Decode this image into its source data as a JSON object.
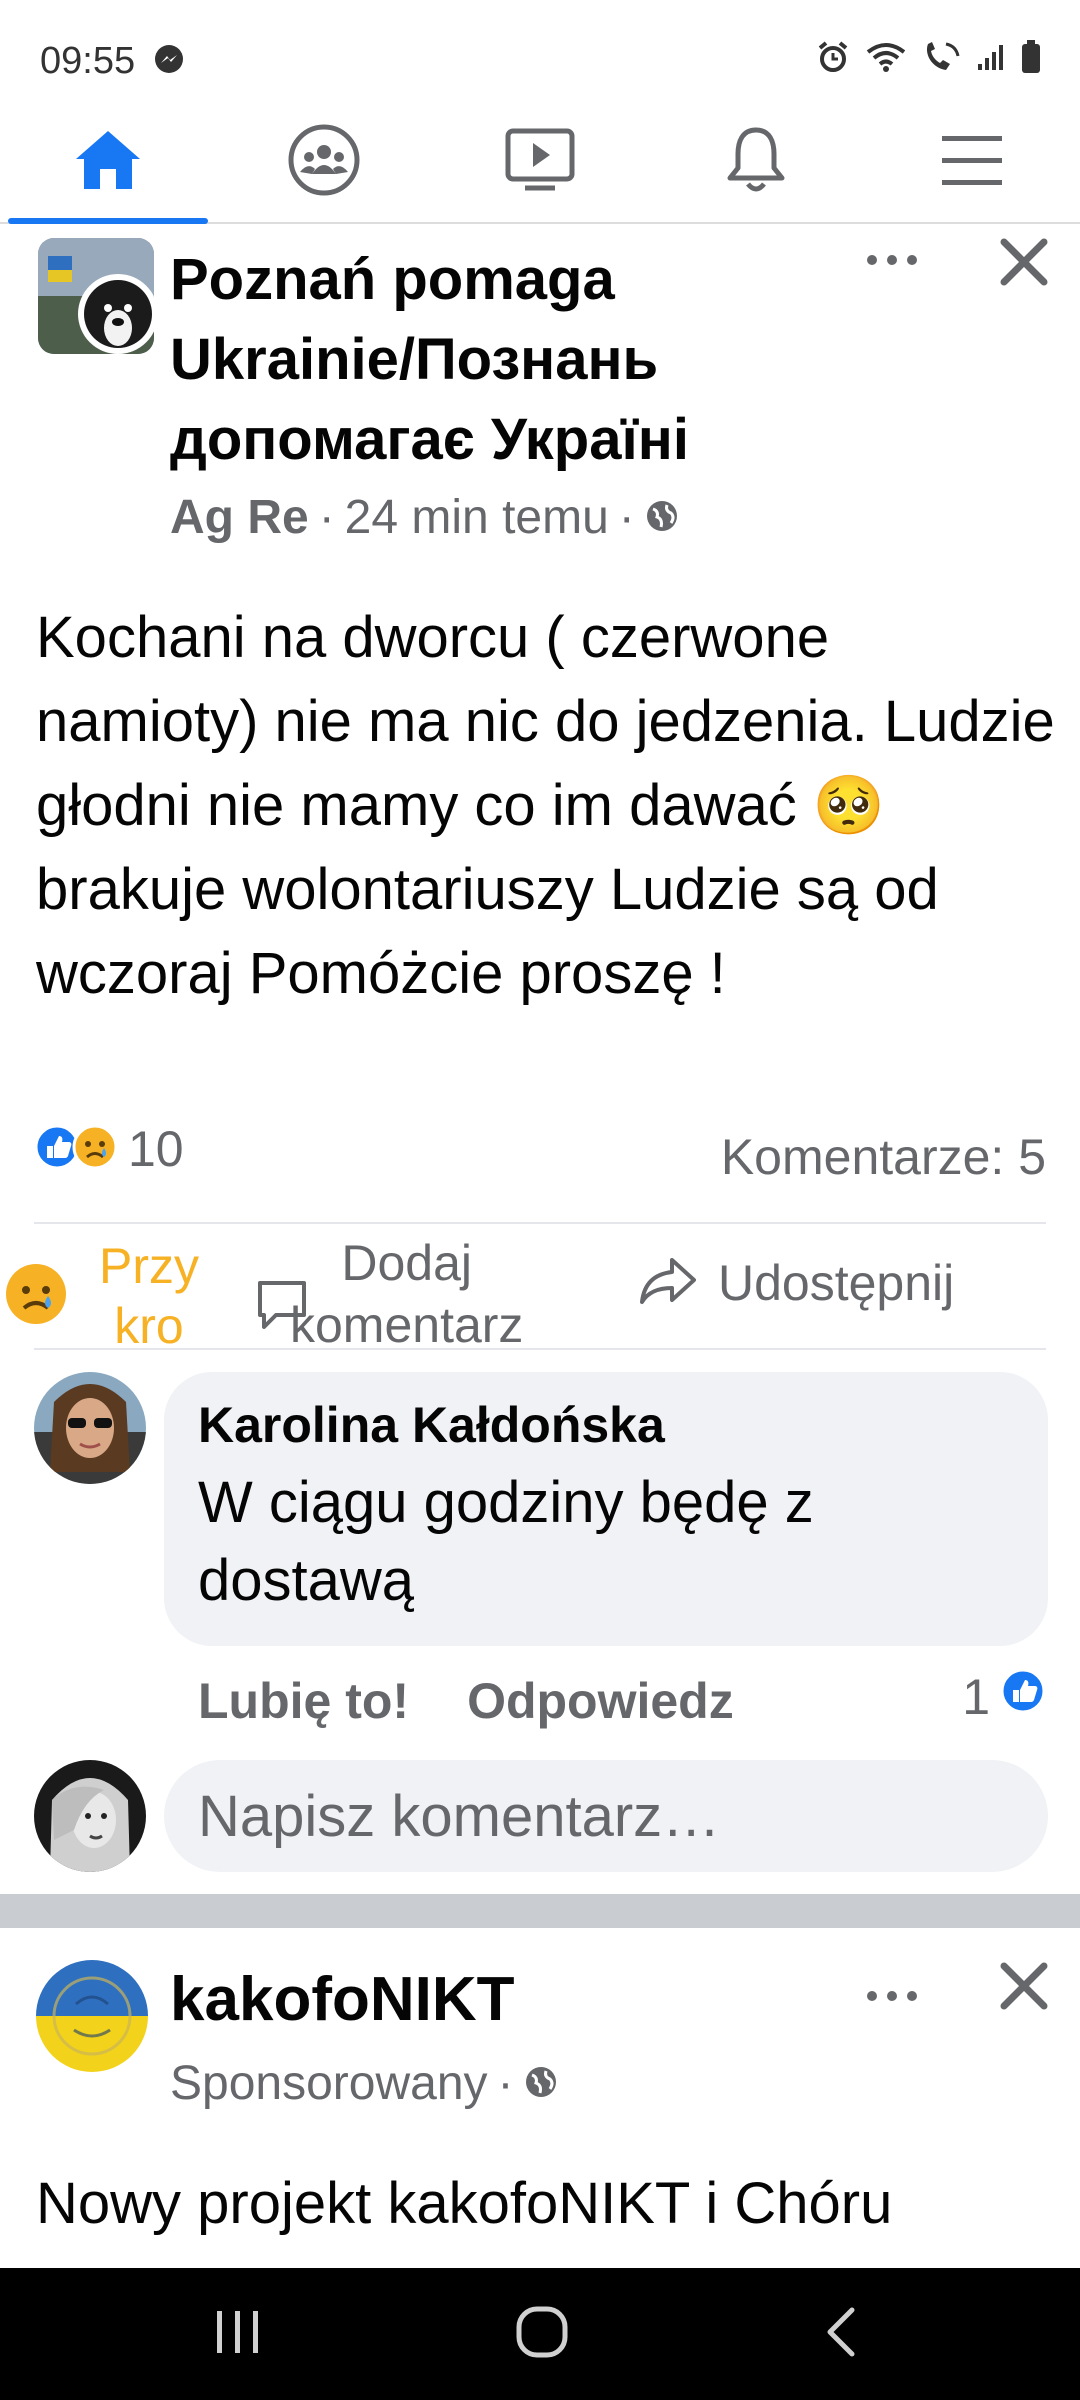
{
  "status_bar": {
    "time": "09:55",
    "left_icon": "messenger-icon",
    "right_icons": [
      "alarm-icon",
      "wifi-icon",
      "wifi-call-icon",
      "signal-icon",
      "battery-icon"
    ]
  },
  "nav": {
    "tabs": [
      {
        "name": "home",
        "icon": "home-icon",
        "active": true
      },
      {
        "name": "groups",
        "icon": "groups-icon",
        "active": false
      },
      {
        "name": "watch",
        "icon": "video-icon",
        "active": false
      },
      {
        "name": "notifications",
        "icon": "bell-icon",
        "active": false
      },
      {
        "name": "menu",
        "icon": "hamburger-icon",
        "active": false
      }
    ],
    "accent_color": "#1877f2"
  },
  "post": {
    "group_name": "Poznań pomaga Ukrainie/Познань допомагає Україні",
    "author": "Ag Re",
    "separator": "·",
    "time": "24 min temu",
    "privacy_icon": "globe-icon",
    "text": "Kochani na dworcu ( czerwone namioty) nie ma nic do jedzenia. Ludzie głodni nie mamy co im dawać 🥺 brakuje wolontariuszy Ludzie są od wczoraj Pomóżcie proszę !",
    "reaction_count": "10",
    "comments_label": "Komentarze: 5",
    "actions": {
      "like_emoji": "😥",
      "like_label_line1": "Przy",
      "like_label_line2": "kro",
      "comment_label_line1": "Dodaj",
      "comment_label_line2": "komentarz",
      "share_label": "Udostępnij"
    }
  },
  "comment": {
    "author": "Karolina Kałdońska",
    "text": "W ciągu godziny będę z dostawą",
    "like_action": "Lubię to!",
    "reply_action": "Odpowiedz",
    "like_count": "1"
  },
  "composer": {
    "placeholder": "Napisz komentarz…"
  },
  "post2": {
    "title": "kakofoNIKT",
    "meta": "Sponsorowany",
    "separator": "·",
    "text": "Nowy projekt kakofoNIKT i Chóru"
  }
}
